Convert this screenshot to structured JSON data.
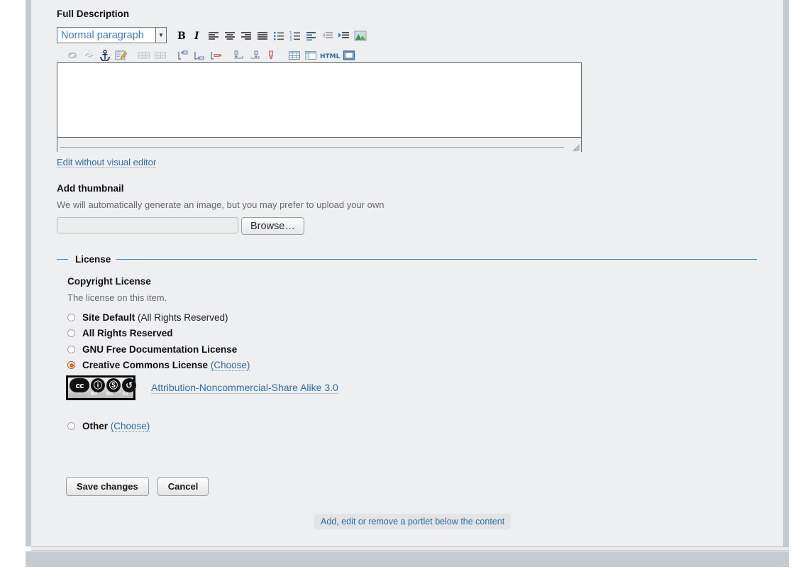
{
  "full_description": {
    "label": "Full Description",
    "format_select": {
      "value": "Normal paragraph",
      "arrow": "▼"
    },
    "toolbar_row1": [
      {
        "name": "bold-icon",
        "title": "Bold"
      },
      {
        "name": "italic-icon",
        "title": "Italic"
      },
      {
        "name": "align-left-icon",
        "title": "Align left"
      },
      {
        "name": "align-center-icon",
        "title": "Align center"
      },
      {
        "name": "align-right-icon",
        "title": "Align right"
      },
      {
        "name": "justify-icon",
        "title": "Justify"
      },
      {
        "name": "bullet-list-icon",
        "title": "Unordered list"
      },
      {
        "name": "numbered-list-icon",
        "title": "Ordered list"
      },
      {
        "name": "definition-list-icon",
        "title": "Definition list"
      },
      {
        "name": "outdent-icon",
        "title": "Outdent"
      },
      {
        "name": "indent-icon",
        "title": "Indent"
      },
      {
        "name": "insert-image-icon",
        "title": "Insert image"
      }
    ],
    "toolbar_row2": [
      {
        "name": "insert-link-icon",
        "title": "Insert link"
      },
      {
        "name": "unlink-icon",
        "title": "Unlink"
      },
      {
        "name": "anchor-icon",
        "title": "Insert anchor"
      },
      {
        "name": "edit-note-icon",
        "title": "Edit"
      },
      {
        "name": "table-row-insert-icon",
        "title": "Insert row"
      },
      {
        "name": "table-cell-insert-icon",
        "title": "Insert cell"
      },
      {
        "name": "row-insert-above-icon",
        "title": "Insert row above"
      },
      {
        "name": "row-insert-below-icon",
        "title": "Insert row below"
      },
      {
        "name": "row-delete-icon",
        "title": "Delete row"
      },
      {
        "name": "column-insert-left-icon",
        "title": "Insert column left"
      },
      {
        "name": "column-insert-right-icon",
        "title": "Insert column right"
      },
      {
        "name": "column-delete-icon",
        "title": "Delete column"
      },
      {
        "name": "insert-table-icon",
        "title": "Insert table"
      },
      {
        "name": "table-properties-icon",
        "title": "Table properties"
      },
      {
        "name": "html-source-icon",
        "title": "HTML source",
        "text": "HTML"
      },
      {
        "name": "fullscreen-icon",
        "title": "Maximize"
      }
    ],
    "editor_content": "",
    "edit_without_visual_editor": "Edit without visual editor"
  },
  "thumbnail": {
    "label": "Add thumbnail",
    "hint": "We will automatically generate an image, but you may prefer to upload your own",
    "file_value": "",
    "browse_label": "Browse…"
  },
  "license": {
    "legend": "License",
    "field_label": "Copyright License",
    "field_hint": "The license on this item.",
    "options": [
      {
        "bold": "Site Default",
        "plain": " (All Rights Reserved)",
        "checked": false
      },
      {
        "bold": "All Rights Reserved",
        "plain": "",
        "checked": false
      },
      {
        "bold": "GNU Free Documentation License",
        "plain": "",
        "checked": false
      },
      {
        "bold": "Creative Commons License",
        "plain": "",
        "checked": true,
        "choose": "(Choose)"
      }
    ],
    "cc_badge": {
      "mark": "cc",
      "icons": [
        "ⓘ",
        "Ⓢ",
        "↺"
      ],
      "tags": [
        "BY",
        "NC",
        "SA"
      ]
    },
    "cc_license_link": "Attribution-Noncommercial-Share Alike 3.0",
    "other": {
      "bold": "Other",
      "choose": "(Choose)",
      "checked": false
    },
    "accent_color": "#2a8ec4",
    "radio_selected_color": "#e2661a"
  },
  "form_buttons": {
    "save": "Save changes",
    "cancel": "Cancel"
  },
  "portlet_hint": "Add, edit or remove a portlet below the content"
}
